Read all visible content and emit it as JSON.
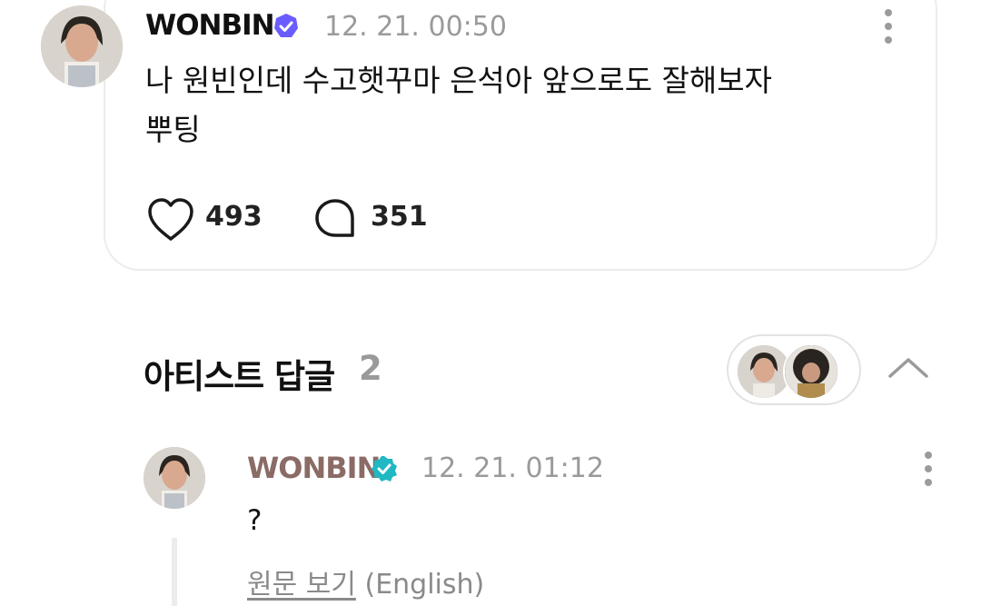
{
  "post": {
    "author": "WONBIN",
    "time": "12. 21. 00:50",
    "text_line1": "나 원빈인데 수고햇꾸마 은석아 앞으로도 잘해보자",
    "text_line2": "뿌팅",
    "like_count": "493",
    "comment_count": "351",
    "badge_color": "#6b5cff",
    "icons": {
      "verified": "verified-badge-icon",
      "more": "more-vertical-icon",
      "like": "heart-icon",
      "comment": "comment-bubble-icon"
    }
  },
  "artist_replies": {
    "title": "아티스트 답글",
    "count": "2",
    "collapse_icon": "chevron-up-icon"
  },
  "reply": {
    "author": "WONBIN",
    "time": "12. 21. 01:12",
    "text": "?",
    "view_original_link": "원문 보기",
    "view_original_lang": "(English)",
    "author_color": "#8a6b66",
    "badge_color": "#1fb8c3"
  }
}
